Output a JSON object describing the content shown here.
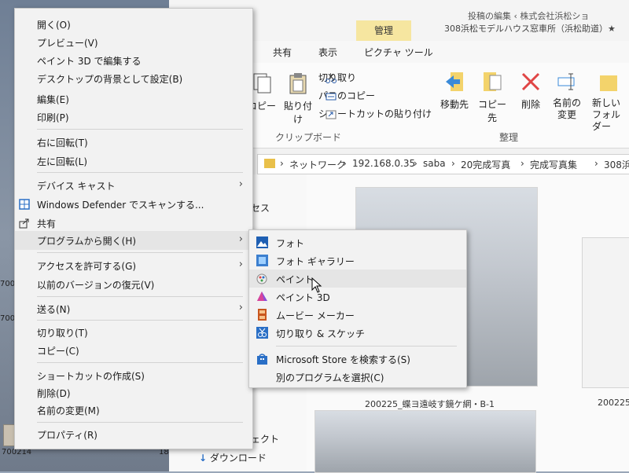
{
  "desktop": {
    "labels": [
      "700214",
      "18",
      "700",
      "700"
    ]
  },
  "explorer": {
    "manage_tab": "管理",
    "title_path": "308浜松モデルハウス窓車所（浜松助道）★",
    "top_right_text": "投稿の編集 ‹ 株式会社浜松ショ",
    "ribbon_tabs": [
      "共有",
      "表示",
      "ピクチャ ツール"
    ],
    "ribbon": {
      "copy": "コピー",
      "paste": "貼り付け",
      "cut": "切り取り",
      "copy_path": "パスのコピー",
      "paste_shortcut": "ショートカットの貼り付け",
      "move_to": "移動先",
      "copy_to": "コピー先",
      "delete": "削除",
      "rename_line1": "名前の",
      "rename_line2": "変更",
      "new_folder_line1": "新しい",
      "new_folder_line2": "フォルダー",
      "group_clipboard": "クリップボード",
      "group_organize": "整理"
    },
    "address": [
      "ネットワーク",
      "192.168.0.35",
      "saba",
      "20完成写真",
      "完成写真集",
      "308浜"
    ],
    "nav": {
      "quick_access": "セス",
      "objects": "ェクト",
      "downloads": "ダウンロード"
    },
    "thumbnails": [
      "200225_蝶ヨ遠岐す鏡ケ網・B-1",
      "200225_"
    ]
  },
  "context_menu": {
    "items": [
      {
        "label": "開く(O)"
      },
      {
        "label": "プレビュー(V)"
      },
      {
        "label": "ペイント 3D で編集する"
      },
      {
        "label": "デスクトップの背景として設定(B)"
      },
      {
        "label": "編集(E)"
      },
      {
        "label": "印刷(P)"
      },
      {
        "label": "右に回転(T)"
      },
      {
        "label": "左に回転(L)"
      },
      {
        "label": "デバイス キャスト"
      },
      {
        "label": "Windows Defender でスキャンする..."
      },
      {
        "label": "共有"
      },
      {
        "label": "プログラムから開く(H)"
      },
      {
        "label": "アクセスを許可する(G)"
      },
      {
        "label": "以前のバージョンの復元(V)"
      },
      {
        "label": "送る(N)"
      },
      {
        "label": "切り取り(T)"
      },
      {
        "label": "コピー(C)"
      },
      {
        "label": "ショートカットの作成(S)"
      },
      {
        "label": "削除(D)"
      },
      {
        "label": "名前の変更(M)"
      },
      {
        "label": "プロパティ(R)"
      }
    ],
    "arrow": "›"
  },
  "submenu": {
    "items": [
      {
        "label": "フォト"
      },
      {
        "label": "フォト ギャラリー"
      },
      {
        "label": "ペイント"
      },
      {
        "label": "ペイント 3D"
      },
      {
        "label": "ムービー メーカー"
      },
      {
        "label": "切り取り & スケッチ"
      },
      {
        "label": "Microsoft Store を検索する(S)"
      },
      {
        "label": "別のプログラムを選択(C)"
      }
    ]
  },
  "colors": {
    "menu_bg": "#f2f2f2",
    "highlight": "#e5e5e5",
    "manage_tab": "#f6e6a0",
    "delete_red": "#e04545"
  }
}
